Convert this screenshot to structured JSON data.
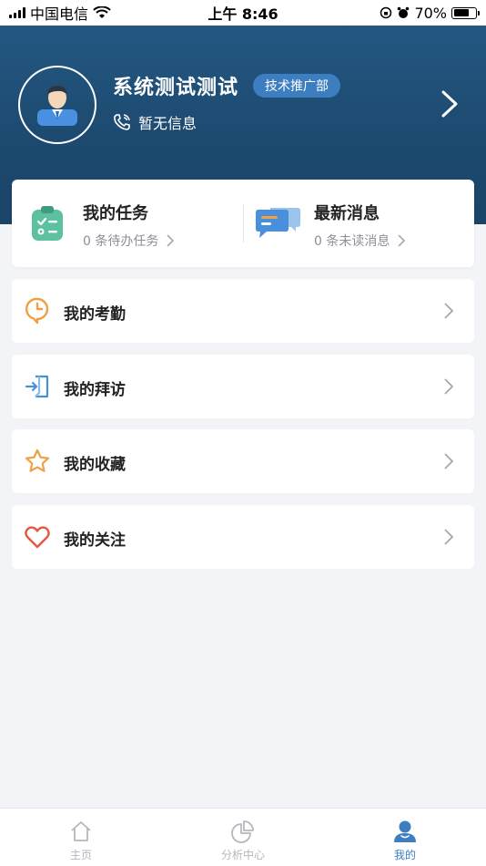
{
  "status_bar": {
    "carrier": "中国电信",
    "time": "上午 8:46",
    "battery": "70%"
  },
  "profile": {
    "name": "系统测试测试",
    "department": "技术推广部",
    "phone_text": "暂无信息"
  },
  "summary": {
    "tasks": {
      "title": "我的任务",
      "sub": "0 条待办任务"
    },
    "messages": {
      "title": "最新消息",
      "sub": "0 条未读消息"
    }
  },
  "menu": [
    {
      "label": "我的考勤",
      "icon": "clock-pin-icon",
      "color": "#f0a043"
    },
    {
      "label": "我的拜访",
      "icon": "enter-door-icon",
      "color": "#4a90d9"
    },
    {
      "label": "我的收藏",
      "icon": "star-icon",
      "color": "#f0a043"
    },
    {
      "label": "我的关注",
      "icon": "heart-icon",
      "color": "#e8553e"
    }
  ],
  "tabbar": {
    "tabs": [
      {
        "label": "主页",
        "icon": "home-icon"
      },
      {
        "label": "分析中心",
        "icon": "pie-chart-icon"
      },
      {
        "label": "我的",
        "icon": "user-icon",
        "active": true
      }
    ]
  },
  "colors": {
    "header": "#1d4a70",
    "accent": "#3d7ec0",
    "background": "#f3f4f8"
  }
}
